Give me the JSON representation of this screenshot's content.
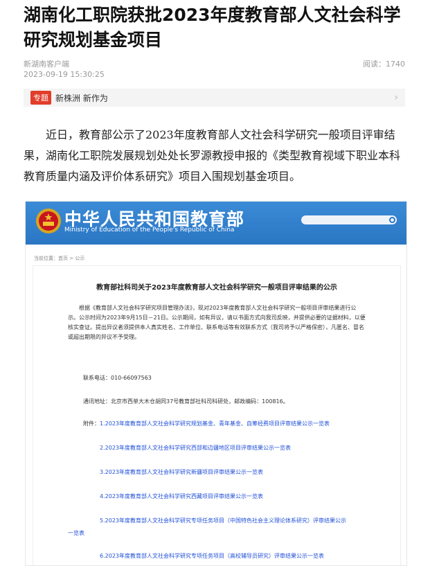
{
  "article": {
    "title": "湖南化工职院获批2023年度教育部人文社会科学研究规划基金项目",
    "source": "新湖南客户端",
    "reads": "阅读：1740",
    "date": "2023-09-19 15:30:25",
    "topic": {
      "tag": "专题",
      "link": "新株洲 新作为"
    },
    "body": "近日，教育部公示了2023年度教育部人文社会科学研究一般项目评审结果，湖南化工职院发展规划处处长罗源教授申报的《类型教育视域下职业本科教育质量内涵及评价体系研究》项目入围规划基金项目。"
  },
  "screenshot": {
    "site_name": "中华人民共和国教育部",
    "site_name_en": "Ministry of Education of the People's Republic of China",
    "breadcrumb": "当前位置：首页 > 公示",
    "doc_title": "教育部社科司关于2023年度教育部人文社会科学研究一般项目评审结果的公示",
    "doc_para": "根据《教育部人文社会科学研究项目管理办法》，现对2023年度教育部人文社会科学研究一般项目评审结果进行公示。公示时间为2023年9月15日－21日。公示期间，如有异议，请以书面方式向我司反映，并提供必要的证据材料，以便核实查证。提出异议者须提供本人真实姓名、工作单位、联系电话等有效联系方式（我司将予以严格保密），凡匿名、冒名或超出期限的异议不予受理。",
    "phone": "联系电话：010-66097563",
    "address": "通讯地址：北京市西单大木仓胡同37号教育部社科司科研处，邮政编码：100816。",
    "attach_label": "附件：",
    "attachments": [
      "1.2023年度教育部人文社会科学研究规划基金、青年基金、自筹经费项目评审结果公示一览表",
      "2.2023年度教育部人文社会科学研究西部和边疆地区项目评审结果公示一览表",
      "3.2023年度教育部人文社会科学研究新疆项目评审结果公示一览表",
      "4.2023年度教育部人文社会科学研究西藏项目评审结果公示一览表",
      "5.2023年度教育部人文社会科学研究专项任务项目（中国特色社会主义理论体系研究）评审结果公示",
      "一览表",
      "6.2023年度教育部人文社会科学研究专项任务项目（高校辅导员研究）评审结果公示一览表"
    ]
  }
}
